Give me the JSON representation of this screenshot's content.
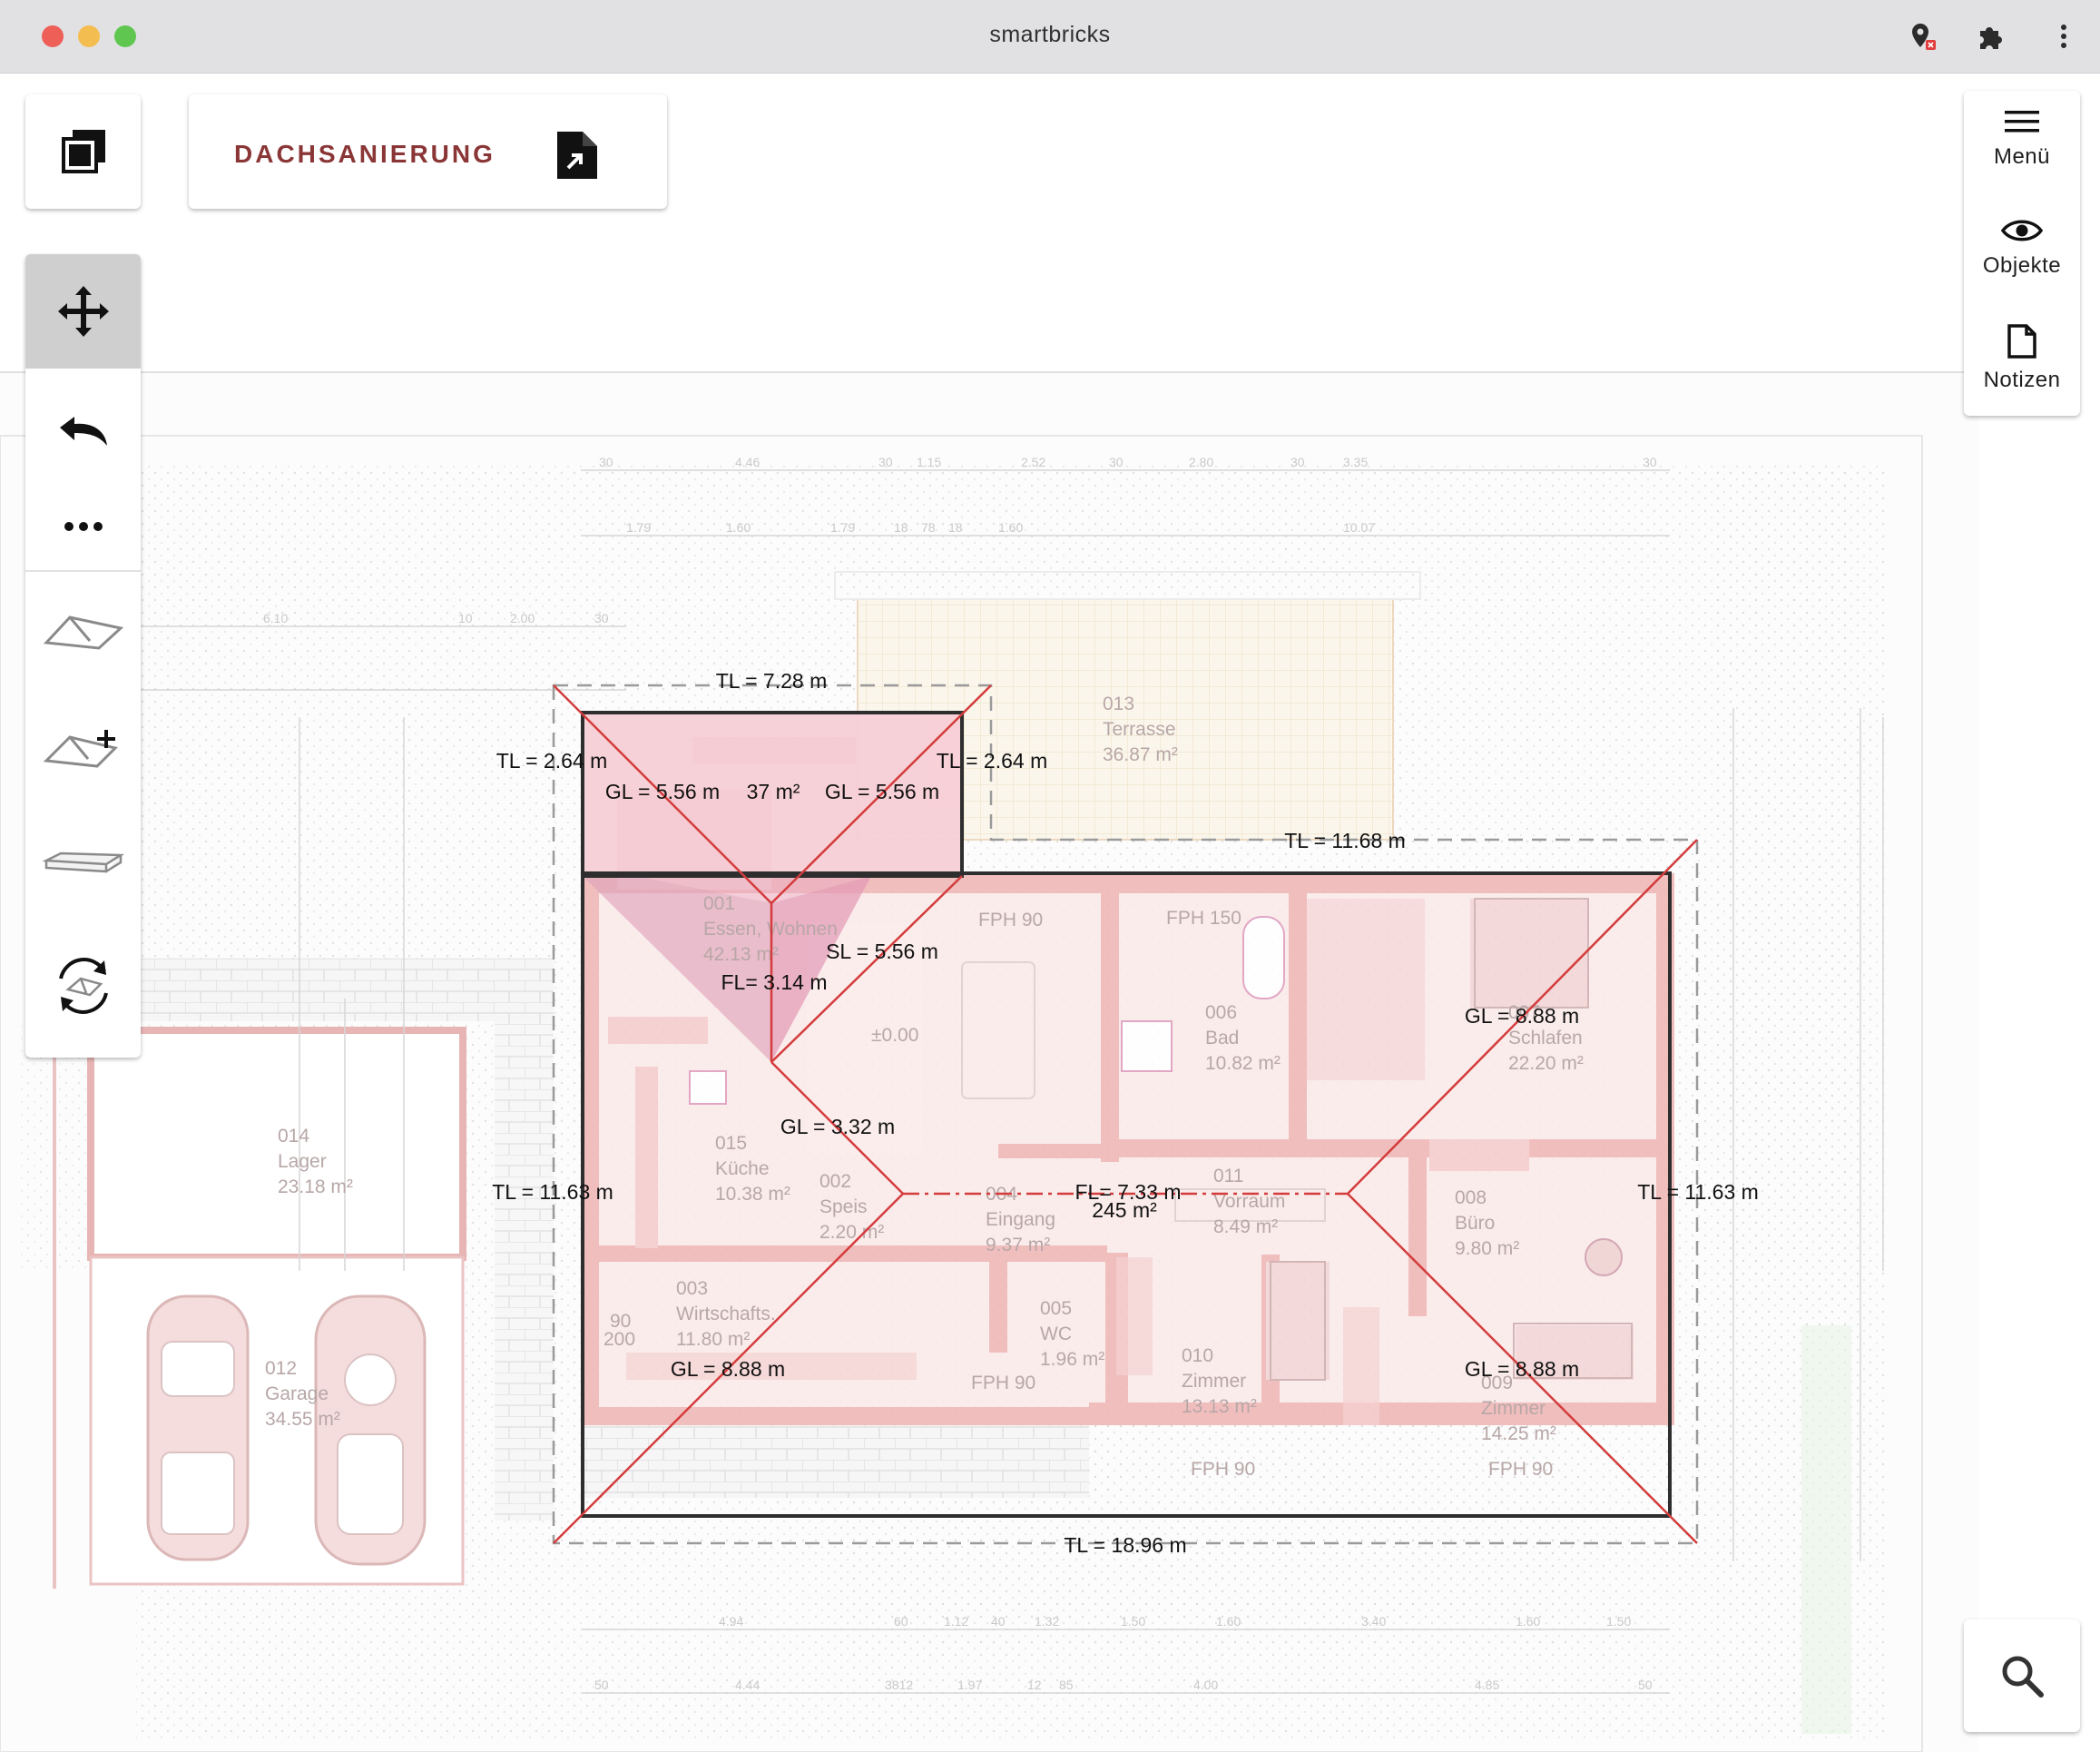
{
  "window": {
    "title": "smartbricks"
  },
  "project": {
    "name": "DACHSANIERUNG"
  },
  "right_panel": {
    "menu_label": "Menü",
    "objects_label": "Objekte",
    "notes_label": "Notizen"
  },
  "measurements": {
    "tl_top_small": "TL = 7.28 m",
    "tl_left_small": "TL = 2.64 m",
    "tl_right_small": "TL = 2.64 m",
    "gl_left_small": "GL = 5.56 m",
    "area_small": "37 m²",
    "gl_right_small": "GL = 5.56 m",
    "tl_top_large": "TL = 11.68 m",
    "sl": "SL = 5.56 m",
    "fl_small": "FL= 3.14 m",
    "gl_right_upper": "GL = 8.88 m",
    "gl_center": "GL = 3.32 m",
    "tl_left_large": "TL = 11.63 m",
    "fl_large": "FL= 7.33 m",
    "area_large": "245 m²",
    "tl_right_large": "TL = 11.63 m",
    "gl_left_lower": "GL = 8.88 m",
    "gl_right_lower": "GL = 8.88 m",
    "tl_bottom": "TL = 18.96 m"
  },
  "rooms": [
    {
      "num": "001",
      "name": "Essen, Wohnen",
      "area": "42.13 m²"
    },
    {
      "num": "013",
      "name": "Terrasse",
      "area": "36.87 m²"
    },
    {
      "num": "006",
      "name": "Bad",
      "area": "10.82 m²"
    },
    {
      "num": "007",
      "name": "Schlafen",
      "area": "22.20 m²"
    },
    {
      "num": "015",
      "name": "Küche",
      "area": "10.38 m²"
    },
    {
      "num": "002",
      "name": "Speis",
      "area": "2.20 m²"
    },
    {
      "num": "004",
      "name": "Eingang",
      "area": "9.37 m²"
    },
    {
      "num": "011",
      "name": "Vorraum",
      "area": "8.49 m²"
    },
    {
      "num": "008",
      "name": "Büro",
      "area": "9.80 m²"
    },
    {
      "num": "014",
      "name": "Lager",
      "area": "23.18 m²"
    },
    {
      "num": "003",
      "name": "Wirtschafts.",
      "area": "11.80 m²"
    },
    {
      "num": "005",
      "name": "WC",
      "area": "1.96 m²"
    },
    {
      "num": "010",
      "name": "Zimmer",
      "area": "13.13 m²"
    },
    {
      "num": "009",
      "name": "Zimmer",
      "area": "14.25 m²"
    },
    {
      "num": "012",
      "name": "Garage",
      "area": "34.55 m²"
    }
  ],
  "plan_labels": {
    "fph_1": "FPH 90",
    "fph_2": "FPH 150",
    "fph_3": "FPH 90",
    "fph_4": "FPH 90",
    "fph_5": "FPH 90",
    "level": "±0.00",
    "door_90": "90",
    "door_200": "200",
    "dims_top": [
      "30",
      "4.46",
      "30",
      "1.15",
      "2.52",
      "30",
      "2.80",
      "30",
      "3.35",
      "30"
    ],
    "dims_second": [
      "1.79",
      "1.60",
      "1.79",
      "18",
      "78",
      "18",
      "1.60",
      "10.07"
    ],
    "dims_left": [
      "6.10",
      "10",
      "2.00",
      "30"
    ],
    "dims_bottom": [
      "4.94",
      "60",
      "1.12",
      "40",
      "1.32",
      "1.50",
      "1.60",
      "3.40",
      "1.60",
      "1.50"
    ],
    "dims_bottom2": [
      "50",
      "4.44",
      "3812",
      "1.97",
      "12",
      "85",
      "4.00",
      "4.85",
      "50"
    ]
  },
  "icons": {
    "layers": "layers-icon",
    "file": "file-export-icon",
    "move": "move-arrows-icon",
    "undo": "undo-icon",
    "more": "more-dots-icon",
    "roof": "roof-shape-icon",
    "roof_add": "roof-add-icon",
    "slab": "slab-icon",
    "rotate": "rotate-roof-icon",
    "menu": "hamburger-menu-icon",
    "eye": "eye-icon",
    "notes": "note-icon",
    "search": "search-icon"
  }
}
